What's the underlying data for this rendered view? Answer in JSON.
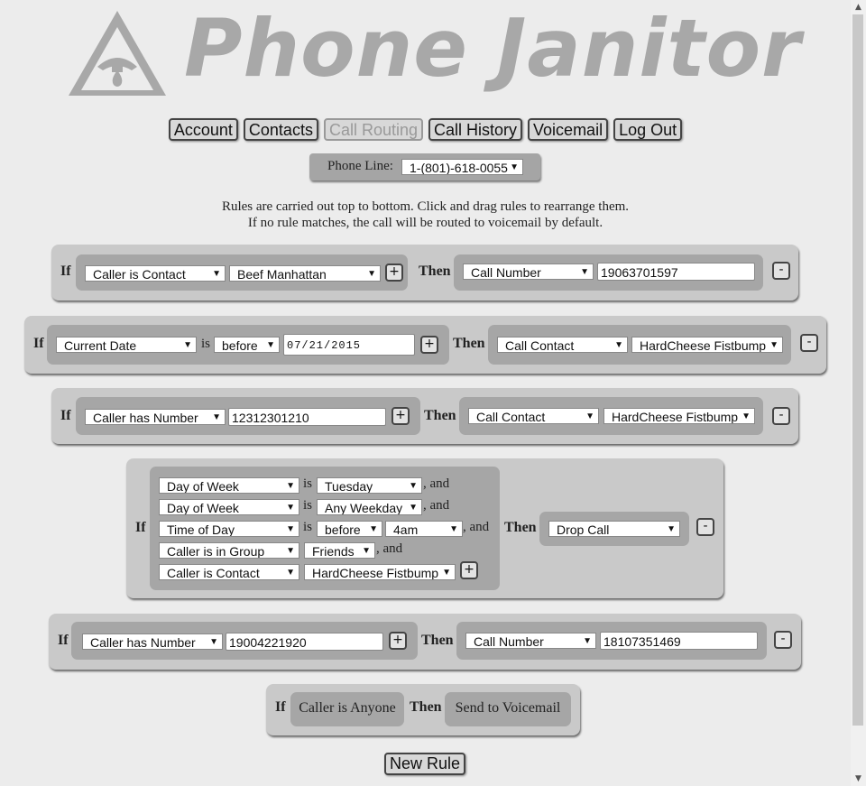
{
  "app": {
    "title": "Phone Janitor"
  },
  "nav": [
    "Account",
    "Contacts",
    "Call Routing",
    "Call History",
    "Voicemail",
    "Log Out"
  ],
  "phone_line": {
    "label": "Phone Line:",
    "value": "1-(801)-618-0055"
  },
  "info": [
    "Rules are carried out top to bottom. Click and drag rules to rearrange them.",
    "If no rule matches, the call will be routed to voicemail by default."
  ],
  "keywords": {
    "if": "If",
    "then": "Then",
    "is": "is",
    "and": ", and",
    "plus": "+",
    "minus": "-"
  },
  "rules": [
    {
      "cond": [
        "Caller is Contact",
        "Beef Manhattan"
      ],
      "action": [
        "Call Number",
        "19063701597"
      ]
    },
    {
      "cond": [
        "Current Date",
        "before",
        "07/21/2015"
      ],
      "action": [
        "Call Contact",
        "HardCheese Fistbump"
      ]
    },
    {
      "cond": [
        "Caller has Number",
        "12312301210"
      ],
      "action": [
        "Call Contact",
        "HardCheese Fistbump"
      ]
    },
    {
      "conds": [
        [
          "Day of Week",
          "Tuesday"
        ],
        [
          "Day of Week",
          "Any Weekday"
        ],
        [
          "Time of Day",
          "before",
          "4am"
        ],
        [
          "Caller is in Group",
          "Friends"
        ],
        [
          "Caller is Contact",
          "HardCheese Fistbump"
        ]
      ],
      "action": [
        "Drop Call"
      ]
    },
    {
      "cond": [
        "Caller has Number",
        "19004221920"
      ],
      "action": [
        "Call Number",
        "18107351469"
      ]
    }
  ],
  "default_rule": {
    "cond": "Caller is Anyone",
    "action": "Send to Voicemail"
  },
  "new_rule_label": "New Rule"
}
